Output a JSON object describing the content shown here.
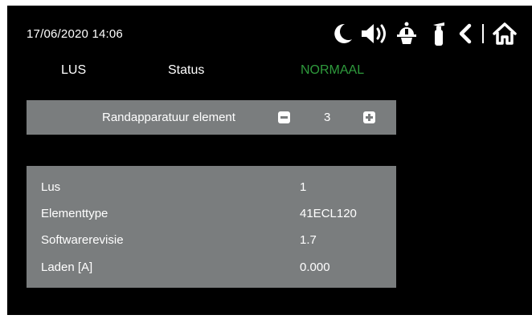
{
  "header": {
    "datetime": "17/06/2020  14:06",
    "icons": [
      "moon-icon",
      "speaker-icon",
      "firefighter-helmet-icon",
      "fire-extinguisher-icon",
      "back-chevron-icon",
      "home-icon"
    ]
  },
  "status_row": {
    "lus_label": "LUS",
    "status_label": "Status",
    "status_value": "NORMAAL"
  },
  "element_selector": {
    "label": "Randapparatuur element",
    "value": "3"
  },
  "details": {
    "rows": [
      {
        "key": "Lus",
        "value": "1"
      },
      {
        "key": "Elementtype",
        "value": "41ECL120"
      },
      {
        "key": "Softwarerevisie",
        "value": "1.7"
      },
      {
        "key": "Laden [A]",
        "value": "0.000"
      }
    ]
  },
  "colors": {
    "background": "#000000",
    "panel": "#7a7d7e",
    "status_ok": "#2e9a3c",
    "text": "#ffffff"
  }
}
